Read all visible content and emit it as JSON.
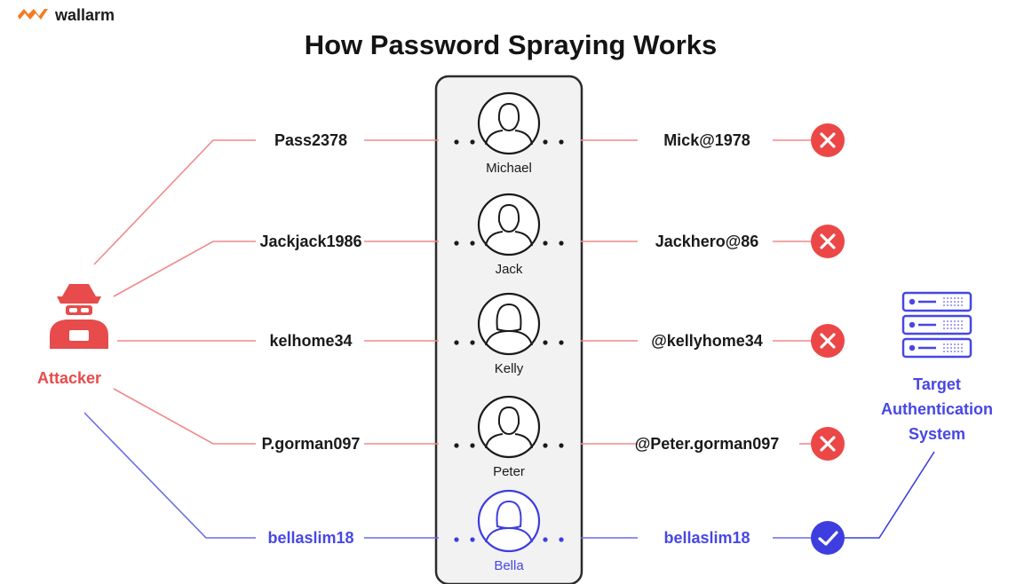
{
  "brand": {
    "name": "wallarm",
    "logo_color": "#f47b20"
  },
  "title": "How Password Spraying Works",
  "attacker": {
    "label": "Attacker",
    "icon": "hacker-icon",
    "color": "#e74b4b"
  },
  "target": {
    "label_lines": [
      "Target",
      "Authentication",
      "System"
    ],
    "icon": "server-icon",
    "color": "#4747e6"
  },
  "rows": [
    {
      "user": "Michael",
      "attempt": "Pass2378",
      "actual": "Mick@1978",
      "result": "fail",
      "avatar": "male-user-icon"
    },
    {
      "user": "Jack",
      "attempt": "Jackjack1986",
      "actual": "Jackhero@86",
      "result": "fail",
      "avatar": "male-user-icon"
    },
    {
      "user": "Kelly",
      "attempt": "kelhome34",
      "actual": "@kellyhome34",
      "result": "fail",
      "avatar": "female-user-icon"
    },
    {
      "user": "Peter",
      "attempt": "P.gorman097",
      "actual": "@Peter.gorman097",
      "result": "fail",
      "avatar": "male-user-icon"
    },
    {
      "user": "Bella",
      "attempt": "bellaslim18",
      "actual": "bellaslim18",
      "result": "success",
      "avatar": "female-user-icon"
    }
  ],
  "colors": {
    "fail": "#ec4747",
    "success": "#3d3de0",
    "fail_line": "#ef8a8a",
    "success_line": "#6b6be8",
    "text": "#1a1a1a"
  }
}
